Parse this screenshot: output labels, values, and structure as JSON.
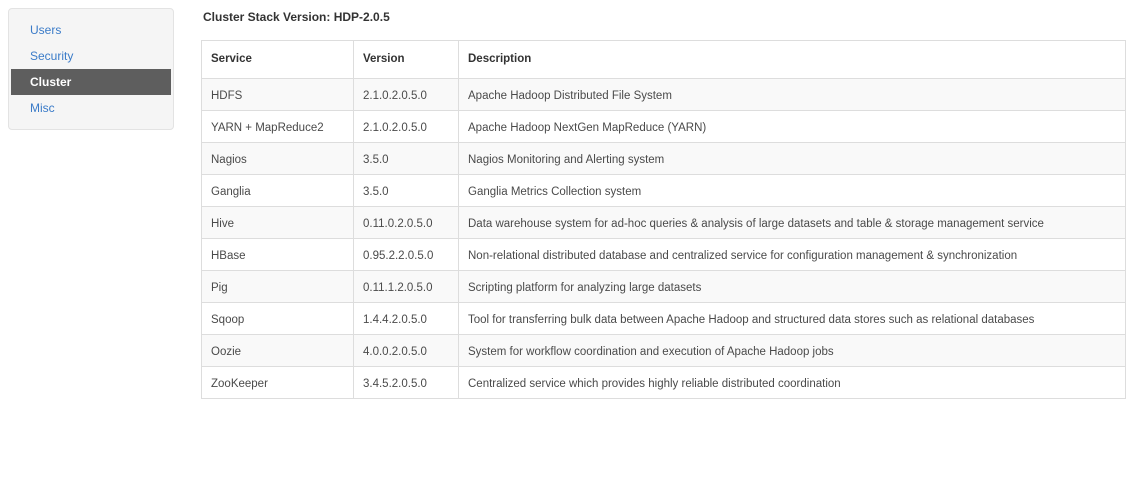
{
  "sidebar": {
    "items": [
      {
        "label": "Users",
        "active": false
      },
      {
        "label": "Security",
        "active": false
      },
      {
        "label": "Cluster",
        "active": true
      },
      {
        "label": "Misc",
        "active": false
      }
    ]
  },
  "main": {
    "stack_title": "Cluster Stack Version: HDP-2.0.5",
    "table": {
      "headers": [
        "Service",
        "Version",
        "Description"
      ],
      "rows": [
        [
          "HDFS",
          "2.1.0.2.0.5.0",
          "Apache Hadoop Distributed File System"
        ],
        [
          "YARN + MapReduce2",
          "2.1.0.2.0.5.0",
          "Apache Hadoop NextGen MapReduce (YARN)"
        ],
        [
          "Nagios",
          "3.5.0",
          "Nagios Monitoring and Alerting system"
        ],
        [
          "Ganglia",
          "3.5.0",
          "Ganglia Metrics Collection system"
        ],
        [
          "Hive",
          "0.11.0.2.0.5.0",
          "Data warehouse system for ad-hoc queries & analysis of large datasets and table & storage management service"
        ],
        [
          "HBase",
          "0.95.2.2.0.5.0",
          "Non-relational distributed database and centralized service for configuration management & synchronization"
        ],
        [
          "Pig",
          "0.11.1.2.0.5.0",
          "Scripting platform for analyzing large datasets"
        ],
        [
          "Sqoop",
          "1.4.4.2.0.5.0",
          "Tool for transferring bulk data between Apache Hadoop and structured data stores such as relational databases"
        ],
        [
          "Oozie",
          "4.0.0.2.0.5.0",
          "System for workflow coordination and execution of Apache Hadoop jobs"
        ],
        [
          "ZooKeeper",
          "3.4.5.2.0.5.0",
          "Centralized service which provides highly reliable distributed coordination"
        ]
      ]
    }
  },
  "colors": {
    "link": "#3a7bc8",
    "active_bg": "#5e5e5e",
    "sidebar_bg": "#f5f5f5",
    "border": "#dddddd"
  }
}
